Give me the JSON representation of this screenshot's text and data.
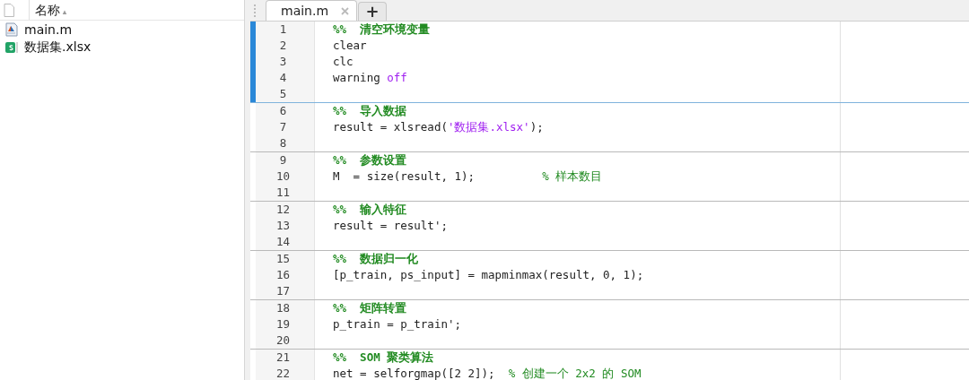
{
  "file_browser": {
    "header": {
      "label": "名称",
      "sort_indicator": "▴"
    },
    "files": [
      {
        "name": "main.m",
        "kind": "m-file",
        "selected": false
      },
      {
        "name": "数据集.xlsx",
        "kind": "spreadsheet",
        "selected": false
      }
    ]
  },
  "editor": {
    "tabs": [
      {
        "label": "main.m",
        "selected": true
      }
    ],
    "new_tab": "+",
    "sections": [
      {
        "selected": true,
        "lines": [
          {
            "number": "1",
            "segments": [
              {
                "kind": "section",
                "text": "%%  清空环境变量"
              }
            ]
          },
          {
            "number": "2",
            "segments": [
              {
                "kind": "plain",
                "text": "clear"
              }
            ]
          },
          {
            "number": "3",
            "segments": [
              {
                "kind": "plain",
                "text": "clc"
              }
            ]
          },
          {
            "number": "4",
            "segments": [
              {
                "kind": "plain",
                "text": "warning "
              },
              {
                "kind": "string",
                "text": "off"
              }
            ]
          },
          {
            "number": "5"
          }
        ]
      },
      {
        "selected": false,
        "lines": [
          {
            "number": "6",
            "segments": [
              {
                "kind": "section",
                "text": "%%  导入数据"
              }
            ]
          },
          {
            "number": "7",
            "segments": [
              {
                "kind": "plain",
                "text": "result = xlsread("
              },
              {
                "kind": "string",
                "text": "'数据集.xlsx'"
              },
              {
                "kind": "plain",
                "text": ");"
              }
            ]
          },
          {
            "number": "8"
          }
        ]
      },
      {
        "selected": false,
        "lines": [
          {
            "number": "9",
            "segments": [
              {
                "kind": "section",
                "text": "%%  参数设置"
              }
            ]
          },
          {
            "number": "10",
            "segments": [
              {
                "kind": "plain",
                "text": "M  = size(result, 1);          "
              },
              {
                "kind": "comment",
                "text": "% 样本数目"
              }
            ]
          },
          {
            "number": "11"
          }
        ]
      },
      {
        "selected": false,
        "lines": [
          {
            "number": "12",
            "segments": [
              {
                "kind": "section",
                "text": "%%  输入特征"
              }
            ]
          },
          {
            "number": "13",
            "segments": [
              {
                "kind": "plain",
                "text": "result = result';"
              }
            ]
          },
          {
            "number": "14"
          }
        ]
      },
      {
        "selected": false,
        "lines": [
          {
            "number": "15",
            "segments": [
              {
                "kind": "section",
                "text": "%%  数据归一化"
              }
            ]
          },
          {
            "number": "16",
            "segments": [
              {
                "kind": "plain",
                "text": "[p_train, ps_input] = mapminmax(result, 0, 1);"
              }
            ]
          },
          {
            "number": "17"
          }
        ]
      },
      {
        "selected": false,
        "lines": [
          {
            "number": "18",
            "segments": [
              {
                "kind": "section",
                "text": "%%  矩阵转置"
              }
            ]
          },
          {
            "number": "19",
            "segments": [
              {
                "kind": "plain",
                "text": "p_train = p_train';"
              }
            ]
          },
          {
            "number": "20"
          }
        ]
      },
      {
        "selected": false,
        "lines": [
          {
            "number": "21",
            "segments": [
              {
                "kind": "section",
                "text": "%%  SOM 聚类算法"
              }
            ]
          },
          {
            "number": "22",
            "segments": [
              {
                "kind": "plain",
                "text": "net = selforgmap([2 2]);  "
              },
              {
                "kind": "comment",
                "text": "% 创建一个 2x2 的 SOM"
              }
            ]
          }
        ]
      }
    ]
  }
}
